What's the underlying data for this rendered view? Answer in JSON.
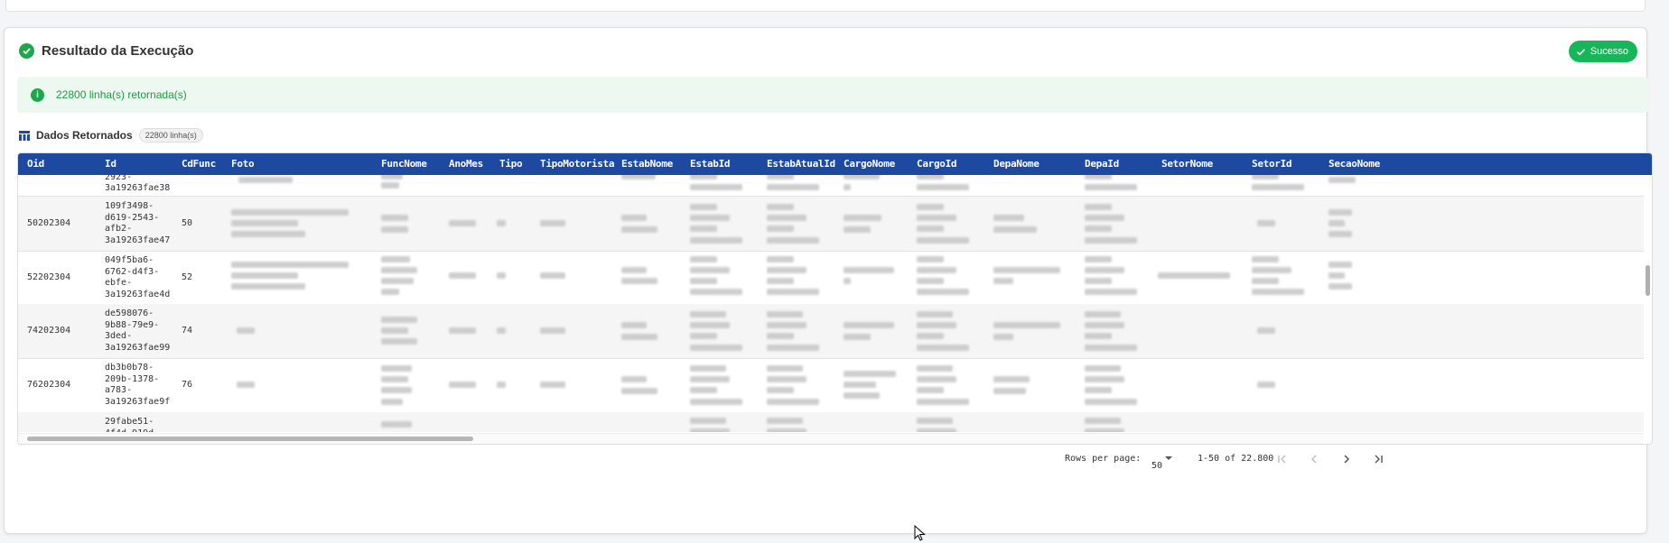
{
  "header": {
    "title": "Resultado da Execução",
    "status_badge": "Sucesso"
  },
  "alert": {
    "message": "22800 linha(s) retornada(s)"
  },
  "section": {
    "title": "Dados Retornados",
    "count_pill": "22800 linha(s)"
  },
  "table": {
    "columns": [
      "Oid",
      "Id",
      "CdFunc",
      "Foto",
      "FuncNome",
      "AnoMes",
      "Tipo",
      "TipoMotorista",
      "EstabNome",
      "EstabId",
      "EstabAtualId",
      "CargoNome",
      "CargoId",
      "DepaNome",
      "DepaId",
      "SetorNome",
      "SetorId",
      "SecaoNome"
    ],
    "rows": [
      {
        "oid": "",
        "id": [
          "2923-",
          "3a19263fae38"
        ],
        "cdfunc": ""
      },
      {
        "oid": "50202304",
        "id": [
          "109f3498-",
          "d619-2543-",
          "afb2-",
          "3a19263fae47"
        ],
        "cdfunc": "50"
      },
      {
        "oid": "52202304",
        "id": [
          "049f5ba6-",
          "6762-d4f3-",
          "ebfe-",
          "3a19263fae4d"
        ],
        "cdfunc": "52"
      },
      {
        "oid": "74202304",
        "id": [
          "de598076-",
          "9b88-79e9-",
          "3ded-",
          "3a19263fae99"
        ],
        "cdfunc": "74"
      },
      {
        "oid": "76202304",
        "id": [
          "db3b0b78-",
          "209b-1378-",
          "a783-",
          "3a19263fae9f"
        ],
        "cdfunc": "76"
      },
      {
        "oid": "",
        "id": [
          "29fabe51-",
          "4f4d-919d"
        ],
        "cdfunc": ""
      }
    ]
  },
  "footer": {
    "rows_per_page_label": "Rows per page:",
    "rows_per_page_value": "50",
    "range": "1-50 of 22.800"
  },
  "icons": [
    "check-circle-icon",
    "check-icon",
    "info-icon",
    "table-icon",
    "chevron-down-icon",
    "first-page-icon",
    "prev-page-icon",
    "next-page-icon",
    "last-page-icon",
    "mouse-cursor-icon"
  ],
  "colors": {
    "header_bg": "#1e49a0",
    "success": "#17b65a",
    "alert_bg": "#ecf8f0",
    "alert_text": "#1f9a45"
  }
}
